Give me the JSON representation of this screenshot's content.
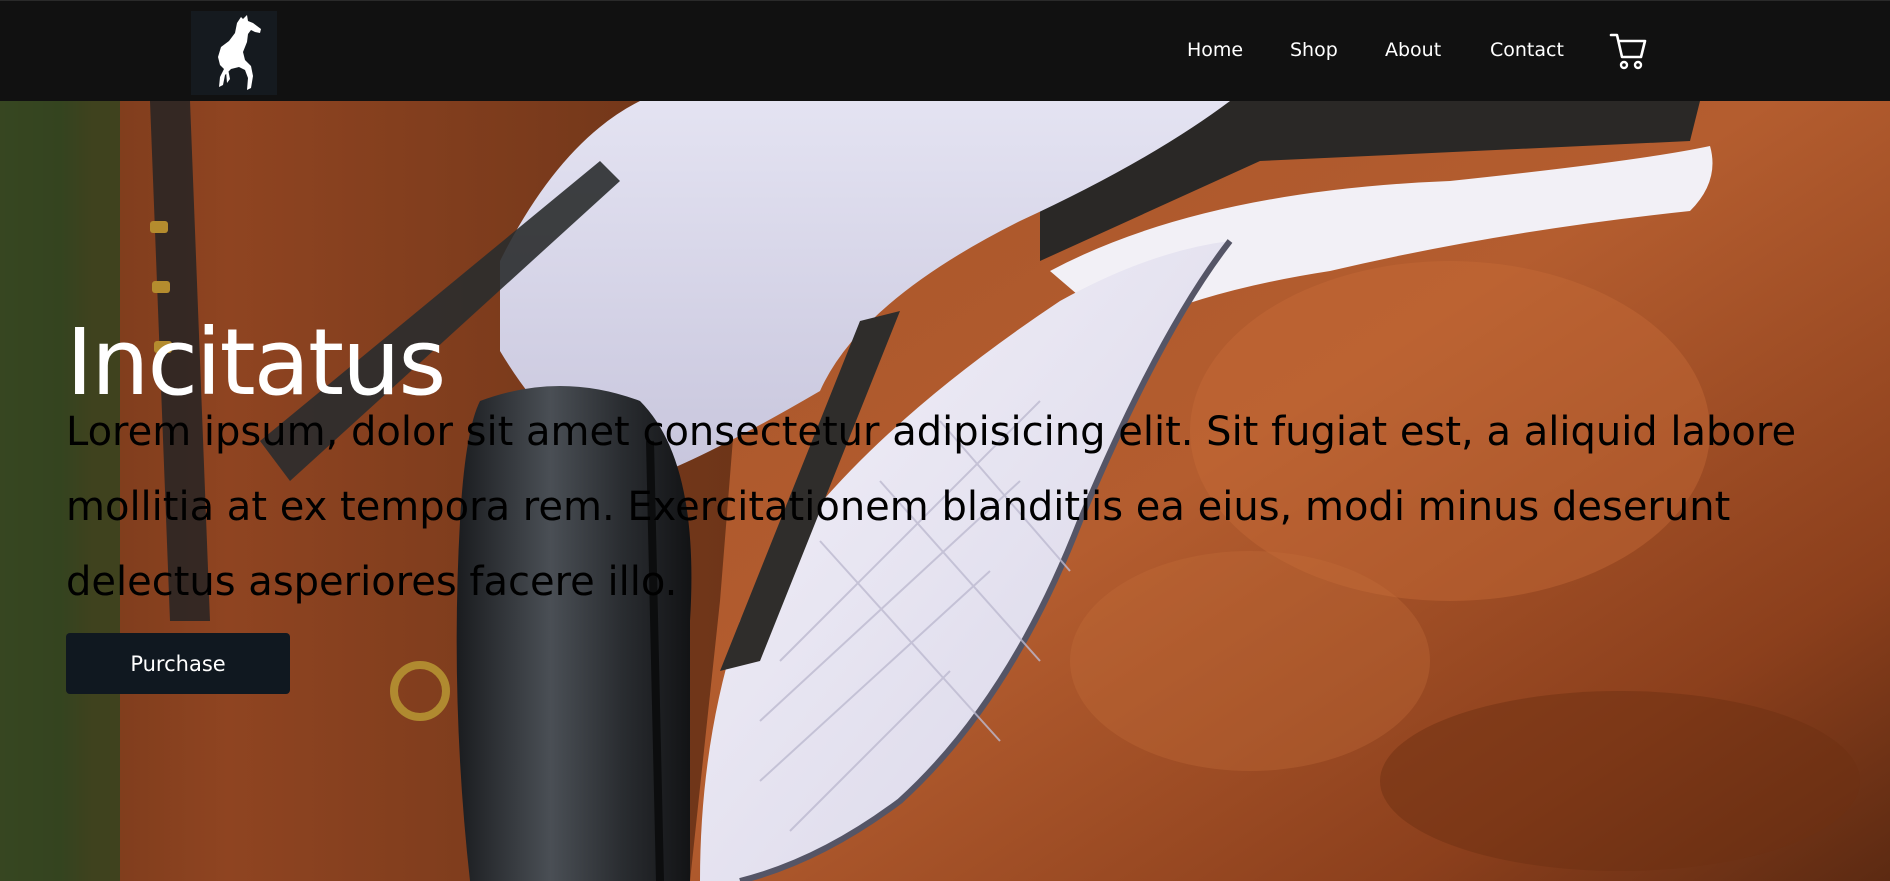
{
  "brand": {
    "logo_icon": "rearing-horse-icon"
  },
  "nav": {
    "items": [
      {
        "label": "Home"
      },
      {
        "label": "Shop"
      },
      {
        "label": "About"
      },
      {
        "label": "Contact"
      }
    ],
    "cart_icon": "shopping-cart-icon"
  },
  "hero": {
    "title": "Incitatus",
    "description": "Lorem ipsum, dolor sit amet consectetur adipisicing elit. Sit fugiat est, a aliquid labore mollitia at ex tempora rem. Exercitationem blanditiis ea eius, modi minus deserunt delectus asperiores facere illo.",
    "button_label": "Purchase",
    "background": "horse-saddle-photo"
  },
  "colors": {
    "navbar_bg": "#111111",
    "nav_text": "#ffffff",
    "button_bg": "#101820",
    "title_text": "#ffffff",
    "body_text": "#000000"
  }
}
